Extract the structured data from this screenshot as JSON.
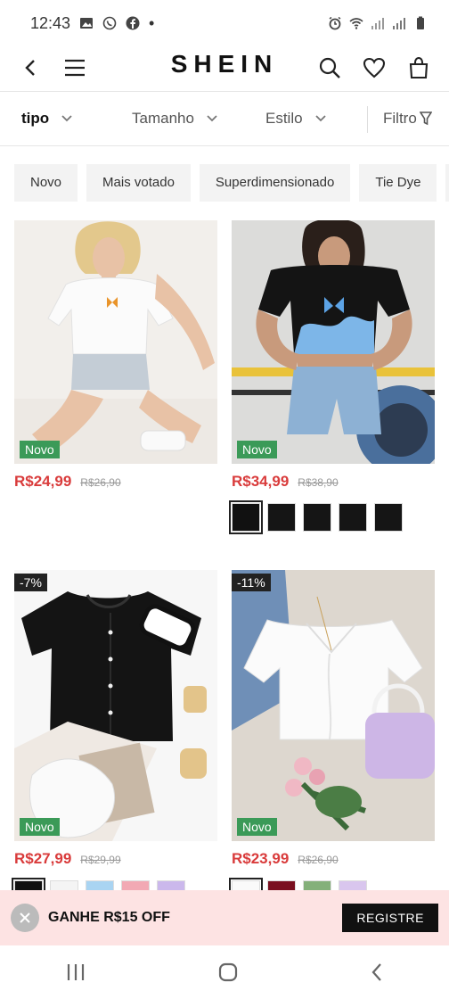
{
  "status_bar": {
    "time": "12:43",
    "dot": "•"
  },
  "header": {
    "brand": "SHEIN"
  },
  "filters": [
    {
      "label": "tipo"
    },
    {
      "label": "Tamanho"
    },
    {
      "label": "Estilo"
    },
    {
      "label": "Filtro"
    }
  ],
  "chips": [
    "Novo",
    "Mais votado",
    "Superdimensionado",
    "Tie Dye"
  ],
  "products": [
    {
      "badge": "Novo",
      "price": "R$24,99",
      "old_price": "R$26,90"
    },
    {
      "badge": "Novo",
      "price": "R$34,99",
      "old_price": "R$38,90"
    },
    {
      "discount": "-7%",
      "badge": "Novo",
      "price": "R$27,99",
      "old_price": "R$29,99"
    },
    {
      "discount": "-11%",
      "badge": "Novo",
      "price": "R$23,99",
      "old_price": "R$26,90"
    }
  ],
  "promo": {
    "text": "GANHE R$15 OFF",
    "button": "REGISTRE"
  },
  "colors": {
    "price_red": "#d93b3b",
    "badge_green": "#3b9a58",
    "promo_bg": "#fde3e3"
  }
}
